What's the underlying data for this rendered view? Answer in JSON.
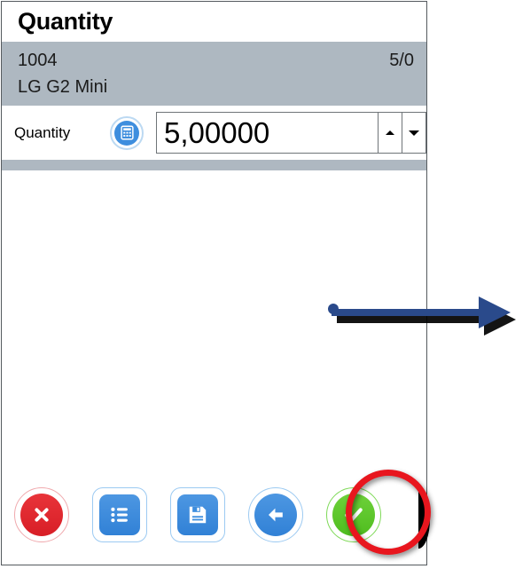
{
  "window": {
    "title": "Quantity"
  },
  "item": {
    "code": "1004",
    "name": "LG G2 Mini",
    "counter": "5/0"
  },
  "quantity_row": {
    "label": "Quantity",
    "calculator_icon": "calculator-icon",
    "value": "5,00000",
    "spinner_up_icon": "triangle-up-icon",
    "spinner_down_icon": "triangle-down-icon"
  },
  "toolbar": {
    "buttons": [
      {
        "name": "cancel-button",
        "icon": "close-x-icon",
        "label": "Cancel",
        "color": "#e2292f"
      },
      {
        "name": "list-button",
        "icon": "list-icon",
        "label": "List",
        "color": "#3e8ede"
      },
      {
        "name": "save-button",
        "icon": "floppy-disk-icon",
        "label": "Save",
        "color": "#3e8ede"
      },
      {
        "name": "back-button",
        "icon": "arrow-left-icon",
        "label": "Back",
        "color": "#3e8ede"
      },
      {
        "name": "confirm-button",
        "icon": "checkmark-icon",
        "label": "Confirm",
        "color": "#5fc92b"
      }
    ]
  },
  "annotations": {
    "highlight_circle": {
      "name": "highlight-circle",
      "target": "confirm-button",
      "color": "#e8161e"
    },
    "pointer_arrow": {
      "name": "pointer-arrow",
      "direction": "right",
      "color": "#2a4a8b"
    }
  },
  "colors": {
    "header_band": "#aeb8c1",
    "accent_blue": "#3e8ede",
    "accent_green": "#5fc92b",
    "accent_red": "#e2292f",
    "annotation_red": "#e8161e",
    "annotation_blue": "#2a4a8b"
  }
}
